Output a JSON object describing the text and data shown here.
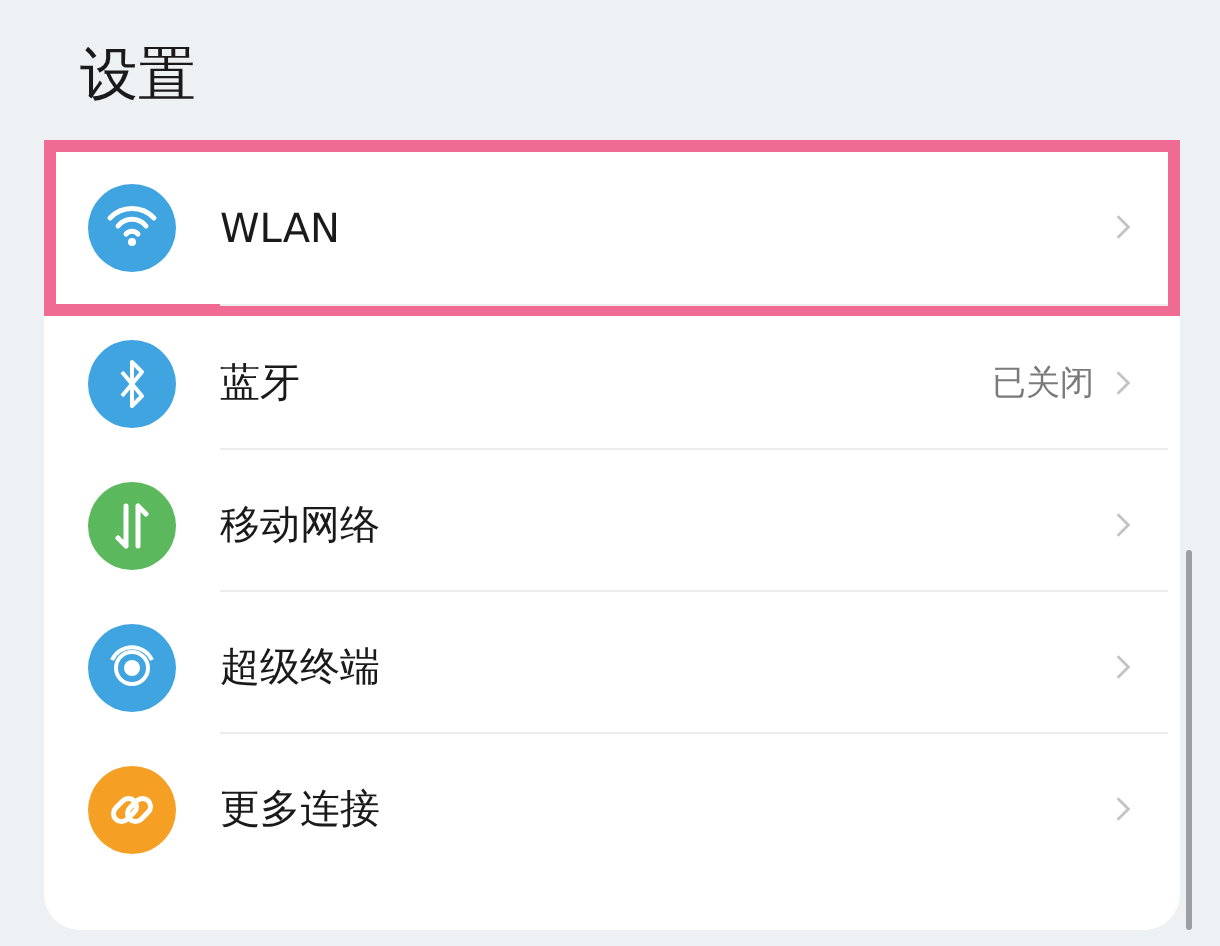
{
  "title": "设置",
  "items": [
    {
      "kind": "wifi",
      "color": "#3fa4e0",
      "label": "WLAN",
      "highlighted": true
    },
    {
      "kind": "bluetooth",
      "color": "#3fa4e0",
      "label": "蓝牙",
      "value": "已关闭",
      "highlighted": false
    },
    {
      "kind": "mobile-data",
      "color": "#5cb85c",
      "label": "移动网络",
      "highlighted": false
    },
    {
      "kind": "super-device",
      "color": "#3fa4e0",
      "label": "超级终端",
      "highlighted": false
    },
    {
      "kind": "link",
      "color": "#f5a024",
      "label": "更多连接",
      "highlighted": false
    }
  ]
}
